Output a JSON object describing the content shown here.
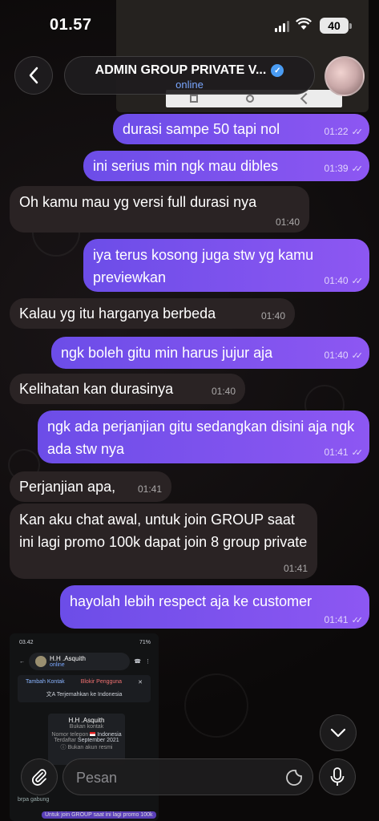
{
  "status": {
    "time": "01.57",
    "battery": "40"
  },
  "header": {
    "title": "ADMIN GROUP PRIVATE V...",
    "subtitle": "online"
  },
  "messages": [
    {
      "dir": "out",
      "text": "durasi sampe 50 tapi nol",
      "time": "01:22"
    },
    {
      "dir": "out",
      "text": "ini serius min ngk mau dibles",
      "time": "01:39"
    },
    {
      "dir": "in",
      "text": "Oh kamu mau yg versi full durasi nya",
      "time": "01:40"
    },
    {
      "dir": "out",
      "text": "iya terus kosong juga stw yg kamu previewkan",
      "time": "01:40"
    },
    {
      "dir": "in",
      "text": "Kalau yg itu harganya berbeda",
      "time": "01:40"
    },
    {
      "dir": "out",
      "text": "ngk boleh gitu min harus jujur aja",
      "time": "01:40"
    },
    {
      "dir": "in",
      "text": "Kelihatan kan durasinya",
      "time": "01:40"
    },
    {
      "dir": "out",
      "text": "ngk ada perjanjian gitu sedangkan disini aja ngk ada stw nya",
      "time": "01:41"
    },
    {
      "dir": "in",
      "text": "Perjanjian apa,",
      "time": "01:41"
    },
    {
      "dir": "in",
      "text": "Kan aku chat awal, untuk join GROUP saat ini lagi promo 100k dapat join 8 group private",
      "time": "01:41"
    },
    {
      "dir": "out",
      "text": "hayolah lebih respect aja ke customer",
      "time": "01:41"
    }
  ],
  "forwarded_screenshot": {
    "status_time": "03.42",
    "battery": "71%",
    "contact_name": "H.H .Asquith",
    "contact_status": "online",
    "add_contact": "Tambah Kontak",
    "block_user": "Blokir Pengguna",
    "translate": "Terjemahkan ke Indonesia",
    "card_name": "H.H .Asquith",
    "card_sub": "Bukan kontak",
    "phone_label": "Nomor telepon",
    "phone_value": "Indonesia",
    "registered_label": "Terdaftar",
    "registered_value": "September 2021",
    "official_note": "Bukan akun resmi",
    "tail_1": "brpa gabung",
    "tail_2": "Untuk join GROUP saat ini lagi promo 100k"
  },
  "composer": {
    "placeholder": "Pesan"
  }
}
